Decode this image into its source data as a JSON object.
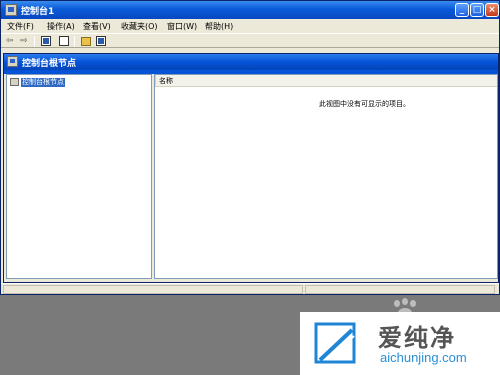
{
  "window": {
    "title": "控制台1",
    "controls": {
      "minimize": "_",
      "maximize": "□",
      "close": "×"
    }
  },
  "menu": [
    {
      "label": "文件(F)"
    },
    {
      "label": "操作(A)"
    },
    {
      "label": "查看(V)"
    },
    {
      "label": "收藏夹(O)"
    },
    {
      "label": "窗口(W)"
    },
    {
      "label": "帮助(H)"
    }
  ],
  "toolbar": {
    "back_icon": "back-arrow-icon",
    "forward_icon": "forward-arrow-icon",
    "back_glyph": "⇦",
    "forward_glyph": "⇨"
  },
  "child_window": {
    "title": "控制台根节点",
    "tree": {
      "root_label": "控制台根节点"
    },
    "list": {
      "column_header": "名称",
      "empty_message": "此视图中没有可显示的项目。"
    }
  },
  "watermark": {
    "brand_cn": "爱纯净",
    "brand_url": "aichunjing.com"
  },
  "colors": {
    "titlebar": "#0553d6",
    "selection": "#316ac5",
    "chrome": "#ece9d8",
    "desktop": "#7a7a7a"
  }
}
